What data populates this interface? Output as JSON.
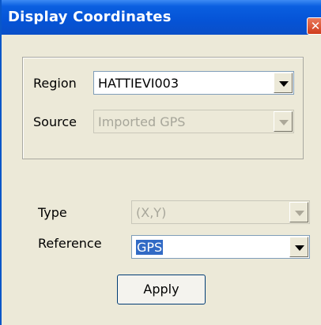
{
  "window": {
    "title": "Display Coordinates",
    "close_glyph": "✕"
  },
  "region": {
    "label": "Region",
    "value": "HATTIEVI003"
  },
  "source": {
    "label": "Source",
    "value": "Imported GPS"
  },
  "type": {
    "label": "Type",
    "value": "(X,Y)"
  },
  "reference": {
    "label": "Reference",
    "value": "GPS"
  },
  "apply_label": "Apply"
}
